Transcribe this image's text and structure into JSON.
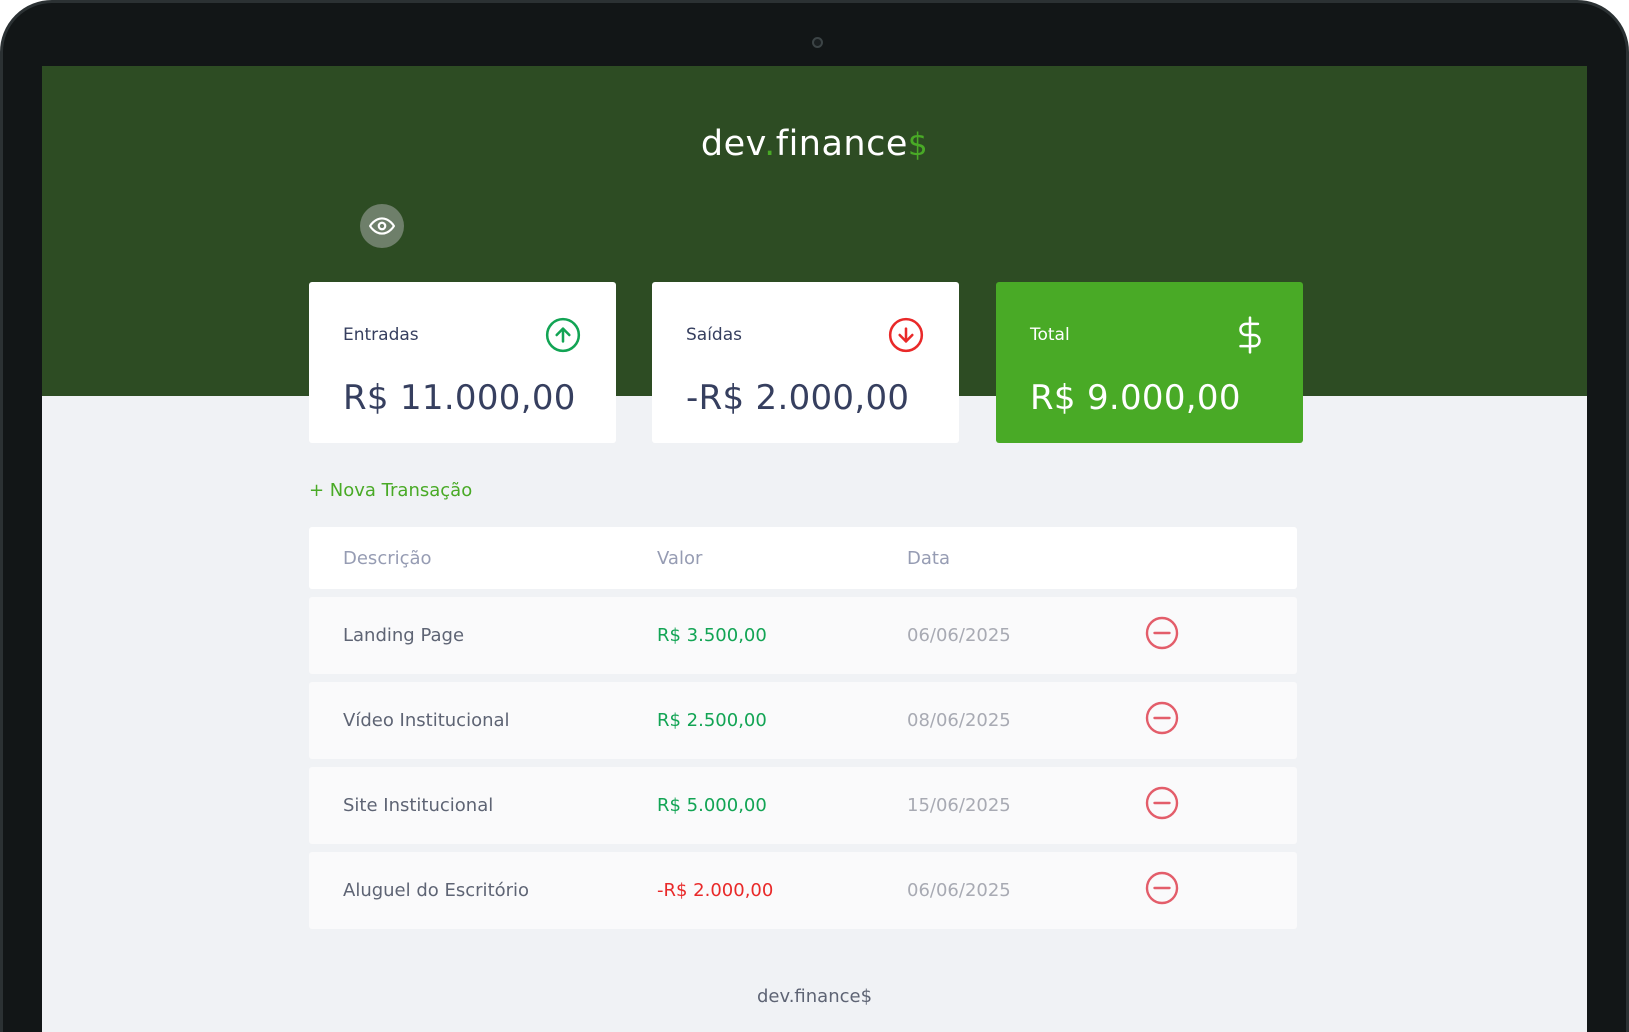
{
  "header": {
    "logo_main": "dev",
    "logo_dot": ".",
    "logo_rest": "finance",
    "logo_dollar": "$"
  },
  "toggle_visibility": {
    "icon": "eye-icon"
  },
  "cards": [
    {
      "title": "Entradas",
      "value": "R$ 11.000,00",
      "icon": "arrow-up-circle-icon",
      "icon_color": "#12a454"
    },
    {
      "title": "Saídas",
      "value": "-R$ 2.000,00",
      "icon": "arrow-down-circle-icon",
      "icon_color": "#e92929"
    },
    {
      "title": "Total",
      "value": "R$ 9.000,00",
      "icon": "dollar-icon",
      "icon_color": "#ffffff"
    }
  ],
  "new_transaction_label": "+ Nova Transação",
  "table": {
    "headers": [
      "Descrição",
      "Valor",
      "Data"
    ],
    "rows": [
      {
        "description": "Landing Page",
        "value": "R$ 3.500,00",
        "date": "06/06/2025",
        "type": "income"
      },
      {
        "description": "Vídeo Institucional",
        "value": "R$ 2.500,00",
        "date": "08/06/2025",
        "type": "income"
      },
      {
        "description": "Site Institucional",
        "value": "R$ 5.000,00",
        "date": "15/06/2025",
        "type": "income"
      },
      {
        "description": "Aluguel do Escritório",
        "value": "-R$ 2.000,00",
        "date": "06/06/2025",
        "type": "expense"
      }
    ]
  },
  "footer_text": "dev.finance$",
  "colors": {
    "header_green": "#2d4c23",
    "accent_green": "#49aa26",
    "income": "#12a454",
    "expense": "#e92929"
  }
}
